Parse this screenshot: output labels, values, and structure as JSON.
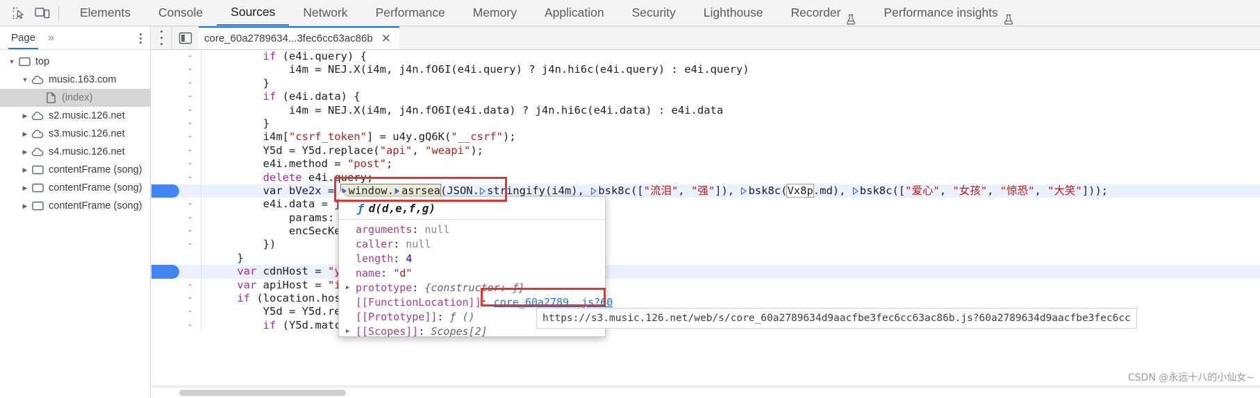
{
  "toolbar": {
    "inspect_icon": "inspect-element-icon",
    "device_icon": "device-toolbar-icon",
    "tabs": [
      {
        "label": "Elements",
        "active": false,
        "flask": false
      },
      {
        "label": "Console",
        "active": false,
        "flask": false
      },
      {
        "label": "Sources",
        "active": true,
        "flask": false
      },
      {
        "label": "Network",
        "active": false,
        "flask": false
      },
      {
        "label": "Performance",
        "active": false,
        "flask": false
      },
      {
        "label": "Memory",
        "active": false,
        "flask": false
      },
      {
        "label": "Application",
        "active": false,
        "flask": false
      },
      {
        "label": "Security",
        "active": false,
        "flask": false
      },
      {
        "label": "Lighthouse",
        "active": false,
        "flask": false
      },
      {
        "label": "Recorder",
        "active": false,
        "flask": true
      },
      {
        "label": "Performance insights",
        "active": false,
        "flask": true
      }
    ]
  },
  "navigator": {
    "tab_label": "Page",
    "more_label": "»",
    "kebab_name": "more-options-icon",
    "tree": [
      {
        "label": "top",
        "indent": 0,
        "twisty": "open",
        "icon": "frame-icon",
        "selected": false
      },
      {
        "label": "music.163.com",
        "indent": 1,
        "twisty": "open",
        "icon": "cloud-icon",
        "selected": false
      },
      {
        "label": "(index)",
        "indent": 2,
        "twisty": "none",
        "icon": "document-icon",
        "selected": true
      },
      {
        "label": "s2.music.126.net",
        "indent": 1,
        "twisty": "closed",
        "icon": "cloud-icon",
        "selected": false
      },
      {
        "label": "s3.music.126.net",
        "indent": 1,
        "twisty": "closed",
        "icon": "cloud-icon",
        "selected": false
      },
      {
        "label": "s4.music.126.net",
        "indent": 1,
        "twisty": "closed",
        "icon": "cloud-icon",
        "selected": false
      },
      {
        "label": "contentFrame (song)",
        "indent": 1,
        "twisty": "closed",
        "icon": "frame-icon",
        "selected": false
      },
      {
        "label": "contentFrame (song)",
        "indent": 1,
        "twisty": "closed",
        "icon": "frame-icon",
        "selected": false
      },
      {
        "label": "contentFrame (song)",
        "indent": 1,
        "twisty": "closed",
        "icon": "frame-icon",
        "selected": false
      }
    ]
  },
  "editor": {
    "kebab_name": "editor-more-options-icon",
    "show_navigator_icon": "toggle-navigator-icon",
    "file_tab": {
      "label": "core_60a2789634...3fec6cc63ac86b",
      "close_label": "✕"
    }
  },
  "code": {
    "lines": [
      {
        "fold": "-",
        "highlighted": false,
        "text": "        if (e4i.query) {"
      },
      {
        "fold": "-",
        "highlighted": false,
        "text": "            i4m = NEJ.X(i4m, j4n.fO6I(e4i.query) ? j4n.hi6c(e4i.query) : e4i.query)"
      },
      {
        "fold": "-",
        "highlighted": false,
        "text": "        }"
      },
      {
        "fold": "-",
        "highlighted": false,
        "text": "        if (e4i.data) {"
      },
      {
        "fold": "-",
        "highlighted": false,
        "text": "            i4m = NEJ.X(i4m, j4n.fO6I(e4i.data) ? j4n.hi6c(e4i.data) : e4i.data"
      },
      {
        "fold": "-",
        "highlighted": false,
        "text": "        }"
      },
      {
        "fold": "-",
        "highlighted": false,
        "text": "        i4m[\"csrf_token\"] = u4y.gQ6K(\"__csrf\");"
      },
      {
        "fold": "-",
        "highlighted": false,
        "text": "        Y5d = Y5d.replace(\"api\", \"weapi\");"
      },
      {
        "fold": "-",
        "highlighted": false,
        "text": "        e4i.method = \"post\";"
      },
      {
        "fold": "-",
        "highlighted": false,
        "text": "        delete e4i.query;"
      },
      {
        "fold": "-",
        "highlighted": true,
        "text": "        var bVe2x = window.asrsea(JSON.stringify(i4m), bsk8c([\"流泪\", \"强\"]), bsk8c(Vx8p.md), bsk8c([\"爱心\", \"女孩\", \"惊恐\", \"大笑\"]));"
      },
      {
        "fold": "-",
        "highlighted": false,
        "text": "        e4i.data = j"
      },
      {
        "fold": "-",
        "highlighted": false,
        "text": "            params:"
      },
      {
        "fold": "-",
        "highlighted": false,
        "text": "            encSecKe"
      },
      {
        "fold": "-",
        "highlighted": false,
        "text": "        })"
      },
      {
        "fold": "",
        "highlighted": false,
        "text": "    }"
      },
      {
        "fold": "-",
        "highlighted": true,
        "text": "    var cdnHost = \"y"
      },
      {
        "fold": "-",
        "highlighted": false,
        "text": "    var apiHost = \"i"
      },
      {
        "fold": "-",
        "highlighted": false,
        "text": "    if (location.hos"
      },
      {
        "fold": "-",
        "highlighted": false,
        "text": "        Y5d = Y5d.re"
      },
      {
        "fold": "-",
        "highlighted": false,
        "text": "        if (Y5d.matc"
      }
    ]
  },
  "popover": {
    "signature": "d(d,e,f,g)",
    "f_glyph": "ƒ",
    "rows": [
      {
        "twisty": false,
        "key": "arguments",
        "sep": ": ",
        "value": "null",
        "vclass": "pnull"
      },
      {
        "twisty": false,
        "key": "caller",
        "sep": ": ",
        "value": "null",
        "vclass": "pnull"
      },
      {
        "twisty": false,
        "key": "length",
        "sep": ": ",
        "value": "4",
        "vclass": "pnum"
      },
      {
        "twisty": false,
        "key": "name",
        "sep": ": ",
        "value": "\"d\"",
        "vclass": "pstr"
      },
      {
        "twisty": true,
        "key": "prototype",
        "sep": ": ",
        "value": "{constructor: ƒ}",
        "vclass": "pobj"
      },
      {
        "twisty": false,
        "key": "[[FunctionLocation]]",
        "sep": ": ",
        "value": "core_60a2789….js?60",
        "vclass": "plink"
      },
      {
        "twisty": false,
        "key": "[[Prototype]]",
        "sep": ": ",
        "value": "ƒ ()",
        "vclass": "pobj"
      },
      {
        "twisty": true,
        "key": "[[Scopes]]",
        "sep": ": ",
        "value": "Scopes[2]",
        "vclass": "pobj"
      }
    ]
  },
  "status": {
    "url": "https://s3.music.126.net/web/s/core_60a2789634d9aacfbe3fec6cc63ac86b.js?60a2789634d9aacfbe3fec6cc"
  },
  "watermark": "CSDN @永远十八的小仙女~",
  "colors": {
    "accent": "#1a73e8",
    "highlight_row": "#ebf0fd",
    "gutter_blue": "#4285f4",
    "annotation_red": "#e8332a",
    "string_red": "#c41a16",
    "keyword_purple": "#a626a4"
  }
}
